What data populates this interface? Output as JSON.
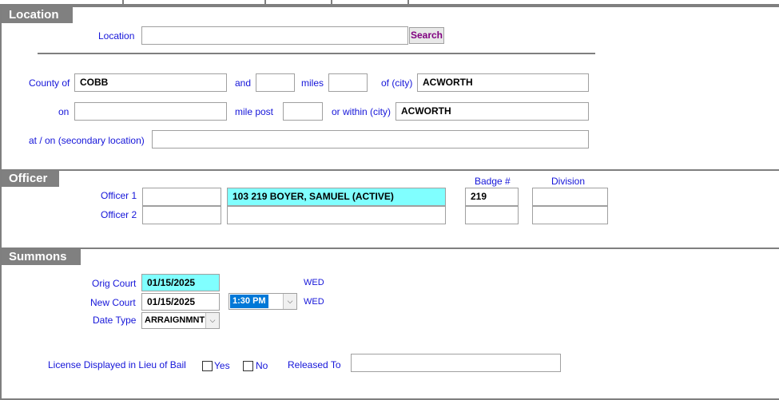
{
  "location": {
    "section_title": "Location",
    "location_label": "Location",
    "location_value": "",
    "search_label": "Search",
    "county_label": "County of",
    "county_value": "COBB",
    "and_label": "and",
    "and_value": "",
    "miles_label": "miles",
    "miles_value": "",
    "of_city_label": "of (city)",
    "of_city_value": "ACWORTH",
    "on_label": "on",
    "on_value": "",
    "mile_post_label": "mile post",
    "mile_post_value": "",
    "within_city_label": "or within (city)",
    "within_city_value": "ACWORTH",
    "secondary_label": "at / on (secondary location)",
    "secondary_value": ""
  },
  "officer": {
    "section_title": "Officer",
    "badge_header": "Badge #",
    "division_header": "Division",
    "officer1_label": "Officer 1",
    "officer1_id": "",
    "officer1_name": "103 219 BOYER, SAMUEL  (ACTIVE)",
    "officer1_badge": "219",
    "officer1_division": "",
    "officer2_label": "Officer 2",
    "officer2_id": "",
    "officer2_name": "",
    "officer2_badge": "",
    "officer2_division": ""
  },
  "summons": {
    "section_title": "Summons",
    "orig_court_label": "Orig Court",
    "orig_court_value": "01/15/2025",
    "orig_court_dow": "WED",
    "new_court_label": "New Court",
    "new_court_value": "01/15/2025",
    "new_court_time": "1:30 PM",
    "new_court_dow": "WED",
    "date_type_label": "Date Type",
    "date_type_value": "ARRAIGNMNT",
    "license_label": "License Displayed in Lieu of Bail",
    "yes_label": "Yes",
    "yes_checked": false,
    "no_label": "No",
    "no_checked": false,
    "released_to_label": "Released To",
    "released_to_value": ""
  },
  "icons": {
    "dropdown": "chevron-down-icon"
  },
  "colors": {
    "label_blue": "#1515d9",
    "header_gray": "#808080",
    "highlight_cyan": "#80ffff",
    "search_purple": "#800080",
    "selection_blue": "#0078d7"
  }
}
